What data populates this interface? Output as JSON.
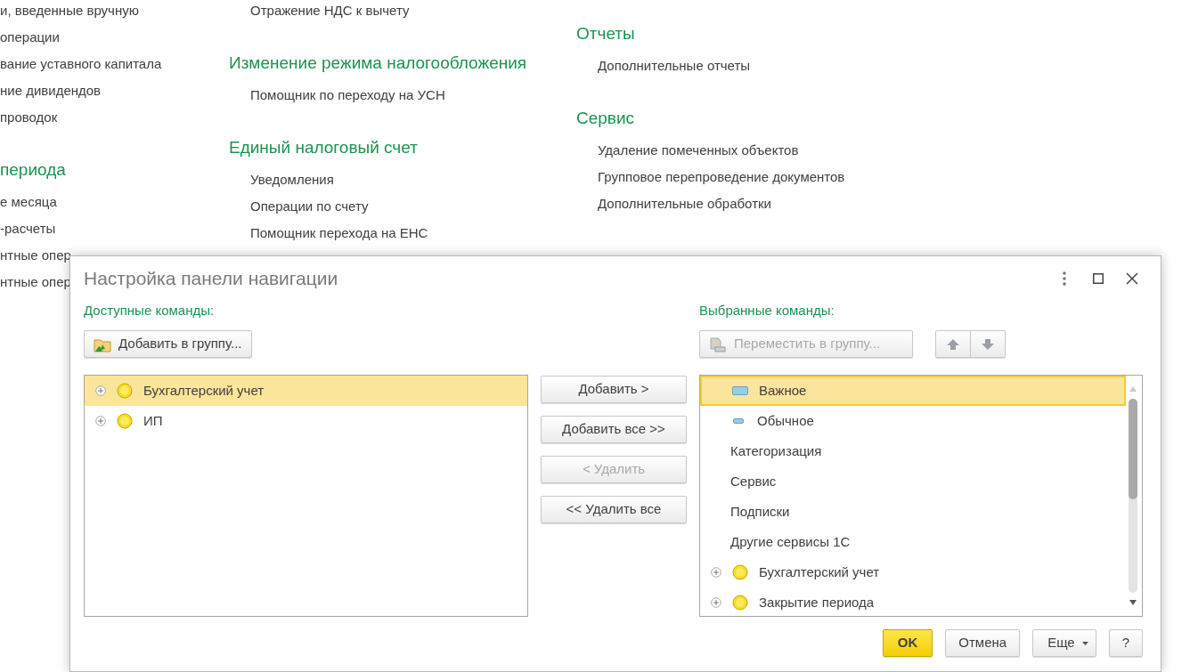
{
  "background": {
    "columns": [
      {
        "sections": [
          {
            "items": [
              "и, введенные вручную",
              "операции",
              "вание уставного капитала",
              "ние дивидендов",
              "проводок"
            ]
          },
          {
            "heading": "периода",
            "items": [
              "е месяца",
              "-расчеты",
              "нтные опер",
              "нтные опер"
            ]
          }
        ]
      },
      {
        "sections": [
          {
            "items": [
              "Отражение НДС к вычету"
            ]
          },
          {
            "heading": "Изменение режима налогообложения",
            "items": [
              "Помощник по переходу на УСН"
            ]
          },
          {
            "heading": "Единый налоговый счет",
            "items": [
              "Уведомления",
              "Операции по счету",
              "Помощник перехода на ЕНС"
            ]
          }
        ]
      },
      {
        "sections": [
          {
            "heading": "Отчеты",
            "items": [
              "Дополнительные отчеты"
            ]
          },
          {
            "heading": "Сервис",
            "items": [
              "Удаление помеченных объектов",
              "Групповое перепроведение документов",
              "Дополнительные обработки"
            ]
          }
        ]
      }
    ]
  },
  "dialog": {
    "title": "Настройка панели навигации",
    "available": {
      "label": "Доступные команды:",
      "add_to_group": {
        "label": "Добавить в группу...",
        "disabled": false
      },
      "items": [
        {
          "kind": "group",
          "text": "Бухгалтерский учет",
          "expanded": false,
          "selected": true
        },
        {
          "kind": "group",
          "text": "ИП",
          "expanded": false,
          "selected": false
        }
      ]
    },
    "transfer_buttons": [
      {
        "label": "Добавить >",
        "disabled": false
      },
      {
        "label": "Добавить все >>",
        "disabled": false
      },
      {
        "label": "< Удалить",
        "disabled": true
      },
      {
        "label": "<< Удалить все",
        "disabled": false
      }
    ],
    "selected_commands": {
      "label": "Выбранные команды:",
      "move_to_group": {
        "label": "Переместить в группу...",
        "disabled": true
      },
      "items": [
        {
          "kind": "tag-large",
          "text": "Важное",
          "selected": true
        },
        {
          "kind": "tag-small",
          "text": "Обычное",
          "selected": false
        },
        {
          "kind": "plain",
          "text": "Категоризация",
          "selected": false
        },
        {
          "kind": "plain",
          "text": "Сервис",
          "selected": false
        },
        {
          "kind": "plain",
          "text": "Подписки",
          "selected": false
        },
        {
          "kind": "plain",
          "text": "Другие сервисы 1С",
          "selected": false
        },
        {
          "kind": "group",
          "text": "Бухгалтерский учет",
          "expanded": false,
          "selected": false
        },
        {
          "kind": "group",
          "text": "Закрытие периода",
          "expanded": false,
          "selected": false
        }
      ]
    },
    "footer_buttons": [
      {
        "kind": "primary",
        "label": "OK"
      },
      {
        "kind": "normal",
        "label": "Отмена"
      },
      {
        "kind": "dropdown",
        "label": "Еще"
      },
      {
        "kind": "normal",
        "label": "?"
      }
    ]
  }
}
